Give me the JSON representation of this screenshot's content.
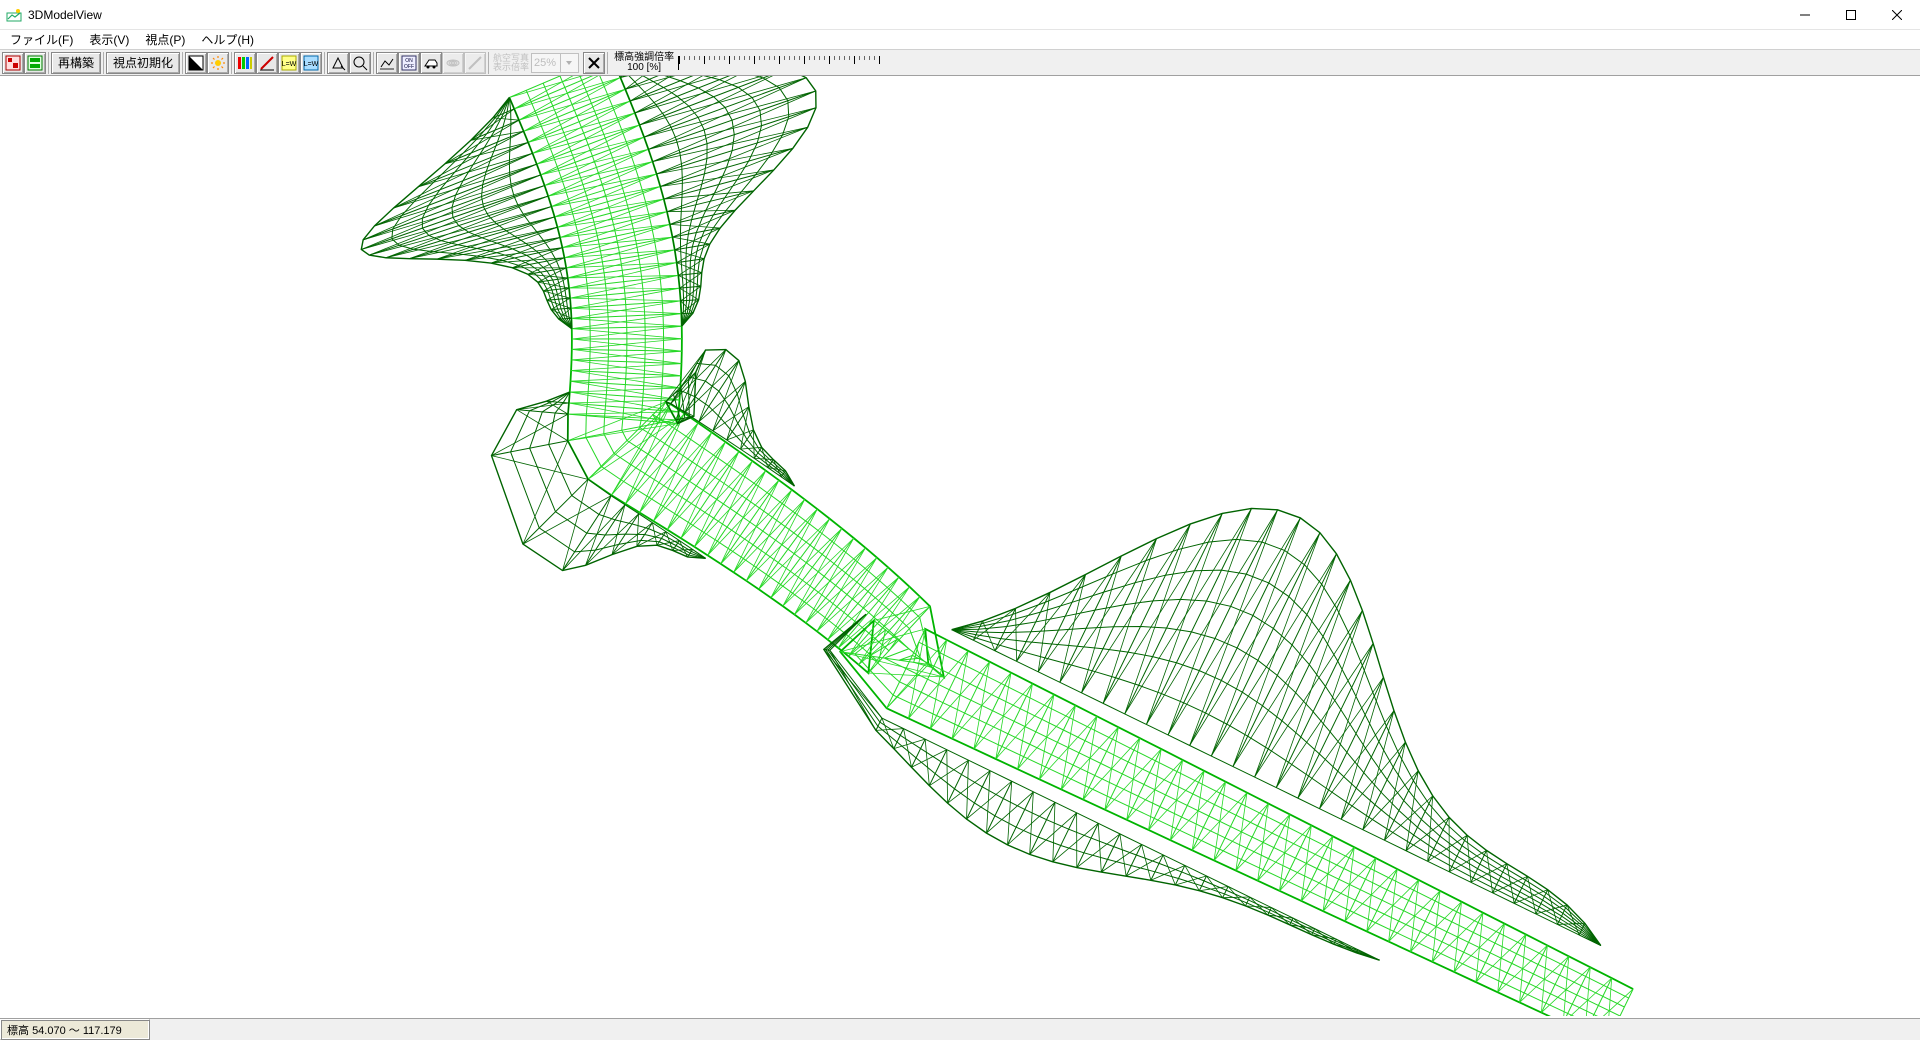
{
  "window": {
    "title": "3DModelView"
  },
  "menu": {
    "file": "ファイル(F)",
    "view": "表示(V)",
    "viewpoint": "視点(P)",
    "help": "ヘルプ(H)"
  },
  "toolbar": {
    "rebuild": "再構築",
    "viewpoint_init": "視点初期化",
    "aerial_photo_line1": "航空写真",
    "aerial_photo_line2": "表示倍率",
    "aerial_percent": "25%",
    "elev_scale_label": "標高強調倍率",
    "elev_scale_value": "100 [%]"
  },
  "status": {
    "elevation_label": "標高",
    "elevation_range": "54.070 ～ 117.179"
  },
  "colors": {
    "wire_light": "#26d826",
    "wire_mid": "#00b400",
    "wire_dark": "#006400",
    "toolbar_bg": "#f0f0f0"
  }
}
